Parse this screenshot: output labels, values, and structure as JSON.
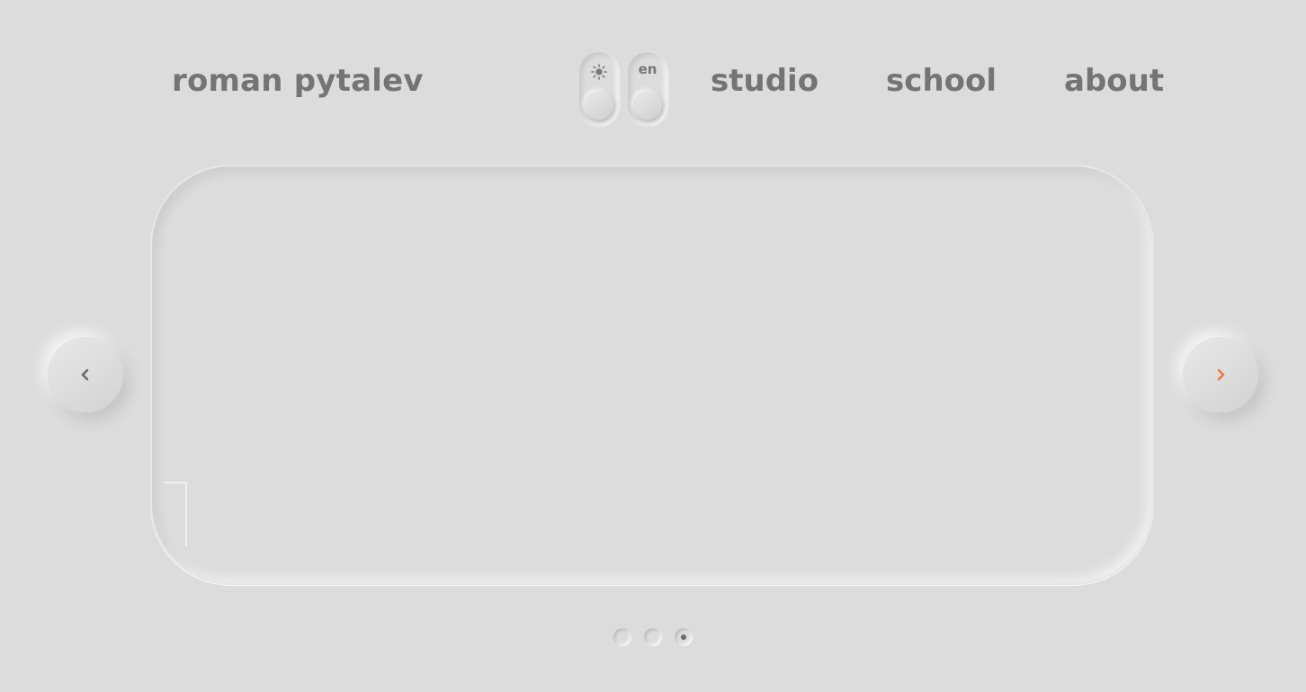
{
  "header": {
    "brand": "roman pytalev",
    "toggles": [
      {
        "id": "theme",
        "icon": "sun-icon"
      },
      {
        "id": "language",
        "label": "en"
      }
    ],
    "nav": [
      {
        "label": "studio"
      },
      {
        "label": "school"
      },
      {
        "label": "about"
      }
    ]
  },
  "carousel": {
    "prev_icon": "chevron-left-icon",
    "next_icon": "chevron-right-icon",
    "dot_count": 3,
    "active_dot": 3,
    "colors": {
      "background": "#dcdcdc",
      "text": "#747474",
      "accent": "#ee7838"
    }
  }
}
